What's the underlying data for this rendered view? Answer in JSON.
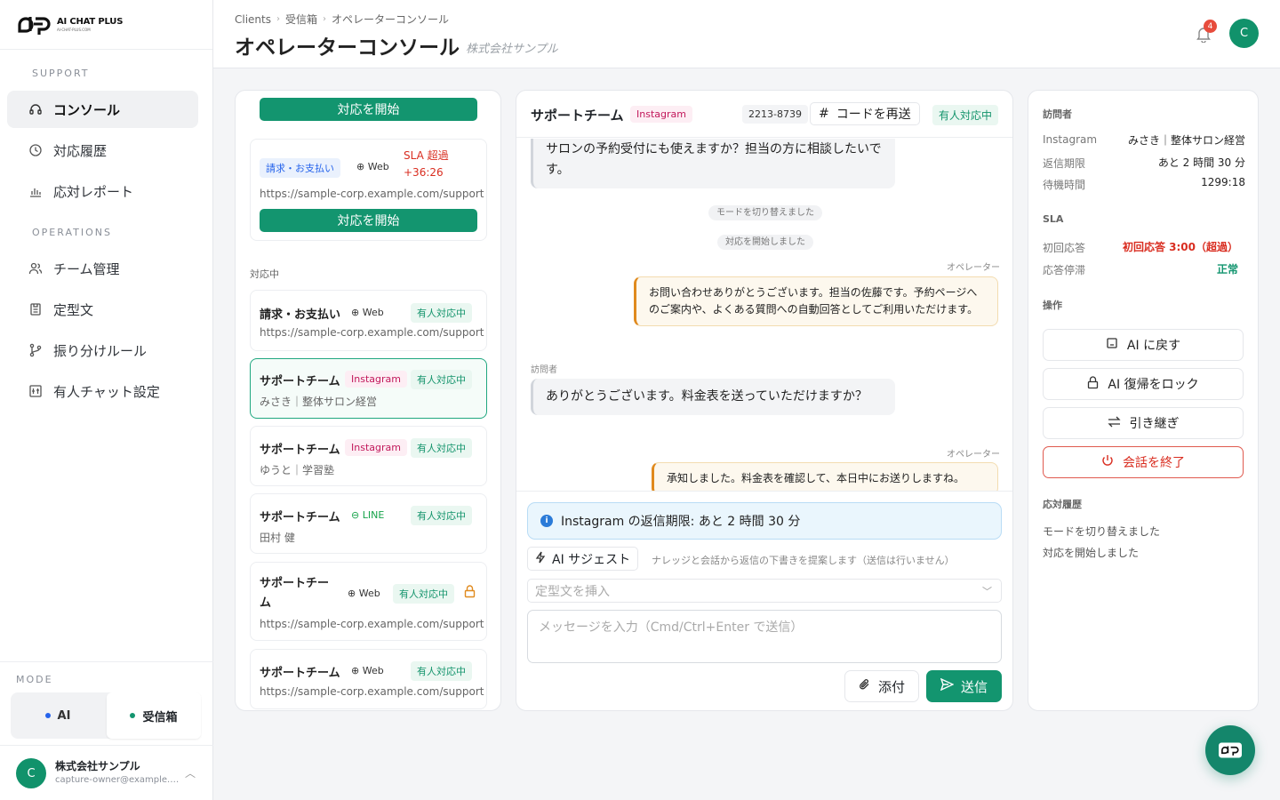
{
  "brand": {
    "name_prefix": "AI CHAT ",
    "name_suffix": "PLUS",
    "domain": "AI-CHAT-PLUS.COM"
  },
  "sidebar": {
    "support_label": "SUPPORT",
    "support_items": [
      {
        "label": "コンソール",
        "icon": "headset-icon",
        "active": true
      },
      {
        "label": "対応履歴",
        "icon": "history-icon"
      },
      {
        "label": "応対レポート",
        "icon": "chart-icon"
      }
    ],
    "operations_label": "OPERATIONS",
    "operations_items": [
      {
        "label": "チーム管理",
        "icon": "team-icon"
      },
      {
        "label": "定型文",
        "icon": "template-icon"
      },
      {
        "label": "振り分けルール",
        "icon": "branch-icon"
      },
      {
        "label": "有人チャット設定",
        "icon": "settings-icon"
      }
    ],
    "mode_label": "MODE",
    "mode_ai": "AI",
    "mode_inbox": "受信箱",
    "user": {
      "initial": "C",
      "name": "株式会社サンプル",
      "email": "capture-owner@example.com"
    }
  },
  "header": {
    "breadcrumb": [
      "Clients",
      "受信箱",
      "オペレーターコンソール"
    ],
    "title": "オペレーターコンソール",
    "subtitle": "株式会社サンプル",
    "notification_count": "4",
    "avatar_initial": "C"
  },
  "queue": {
    "start_label": "対応を開始",
    "card1": {
      "category": "請求・お支払い",
      "channel": "Web",
      "sla": "SLA 超過",
      "sla_time": "+36:26",
      "url": "https://sample-corp.example.com/support"
    },
    "active_group": "対応中",
    "items": [
      {
        "title": "請求・お支払い",
        "channel": "Web",
        "status": "有人対応中",
        "sub": "https://sample-corp.example.com/support"
      },
      {
        "title": "サポートチーム",
        "channel": "Instagram",
        "status": "有人対応中",
        "sub": "みさき｜整体サロン経営"
      },
      {
        "title": "サポートチーム",
        "channel": "Instagram",
        "status": "有人対応中",
        "sub": "ゆうと｜学習塾"
      },
      {
        "title": "サポートチーム",
        "channel": "LINE",
        "status": "有人対応中",
        "sub": "田村 健"
      },
      {
        "title_l1": "サポートチー",
        "title_l2": "ム",
        "channel": "Web",
        "status": "有人対応中",
        "sub": "https://sample-corp.example.com/support"
      },
      {
        "title": "サポートチーム",
        "channel": "Web",
        "status": "有人対応中",
        "sub": "https://sample-corp.example.com/support"
      }
    ]
  },
  "chat": {
    "title": "サポートチーム",
    "channel": "Instagram",
    "number": "2213-8739",
    "resend_label": "コードを再送",
    "status": "有人対応中",
    "messages": {
      "m1": "サロンの予約受付にも使えますか？担当の方に相談したいです。",
      "sys1": "モードを切り替えました",
      "sys2": "対応を開始しました",
      "op_label": "オペレーター",
      "m2": "お問い合わせありがとうございます。担当の佐藤です。予約ページへのご案内や、よくある質問への自動回答としてご利用いただけます。",
      "visitor_label": "訪問者",
      "m3": "ありがとうございます。料金表を送っていただけますか？",
      "m4": "承知しました。料金表を確認して、本日中にお送りしますね。"
    },
    "notice": "Instagram の返信期限: あと 2 時間 30 分",
    "suggest_label": "AI サジェスト",
    "suggest_hint": "ナレッジと会話から返信の下書きを提案します（送信は行いません）",
    "template_placeholder": "定型文を挿入",
    "input_placeholder": "メッセージを入力（Cmd/Ctrl+Enter で送信）",
    "attach_label": "添付",
    "send_label": "送信"
  },
  "info": {
    "visitor_h": "訪問者",
    "visitor": [
      {
        "k": "Instagram",
        "v": "みさき｜整体サロン経営"
      },
      {
        "k": "返信期限",
        "v": "あと 2 時間 30 分"
      },
      {
        "k": "待機時間",
        "v": "1299:18"
      }
    ],
    "sla_h": "SLA",
    "sla": [
      {
        "k": "初回応答",
        "v": "初回応答 3:00（超過）"
      },
      {
        "k": "応答停滞",
        "v": "正常"
      }
    ],
    "ops_h": "操作",
    "actions": [
      "AI に戻す",
      "AI 復帰をロック",
      "引き継ぎ",
      "会話を終了"
    ],
    "history_h": "応対履歴",
    "history": [
      "モードを切り替えました",
      "対応を開始しました"
    ]
  },
  "colors": {
    "accent": "#13956f",
    "danger": "#d92d20",
    "instagram": "#c2185b",
    "warning": "#e08a1e"
  }
}
